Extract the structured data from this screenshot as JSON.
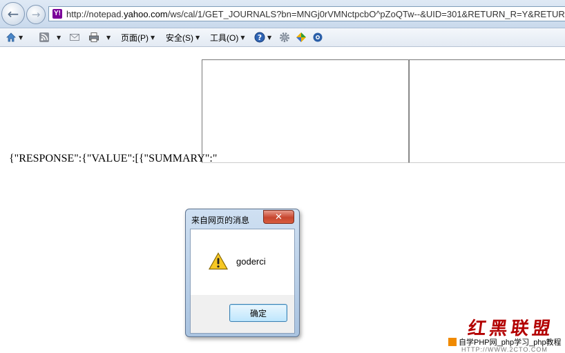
{
  "browser": {
    "address_url_pre": "http://notepad.",
    "address_url_host": "yahoo.com",
    "address_url_post": "/ws/cal/1/GET_JOURNALS?bn=MNGj0rVMNctpcbO^pZoQTw--&UID=301&RETURN_R=Y&RETURN",
    "site_icon_label": "Y!"
  },
  "command_bar": {
    "page_menu": "页面(P)",
    "safety_menu": "安全(S)",
    "tools_menu": "工具(O)"
  },
  "page": {
    "json_text": "{\"RESPONSE\":{\"VALUE\":[{\"SUMMARY\":\""
  },
  "dialog": {
    "title": "来自网页的消息",
    "message": "goderci",
    "ok_label": "确定"
  },
  "watermark": {
    "cn_text": "红黑联盟",
    "php_text": "自学PHP网_php学习_php教程",
    "url_text": "HTTP://WWW.2CTO.COM"
  },
  "colors": {
    "dialog_close": "#c7462f",
    "watermark_red": "#b30000"
  }
}
